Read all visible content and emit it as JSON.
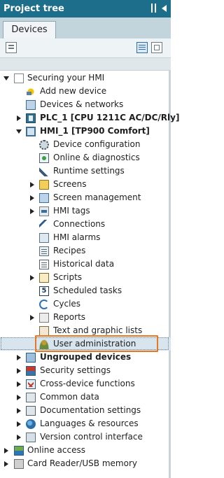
{
  "header": {
    "title": "Project tree"
  },
  "tabs": [
    {
      "label": "Devices"
    }
  ],
  "tree": {
    "rows": [
      {
        "label": "Securing your HMI"
      },
      {
        "label": "Add new device"
      },
      {
        "label": "Devices & networks"
      },
      {
        "label": "PLC_1 [CPU 1211C AC/DC/Rly]"
      },
      {
        "label": "HMI_1 [TP900 Comfort]"
      },
      {
        "label": "Device configuration"
      },
      {
        "label": "Online & diagnostics"
      },
      {
        "label": "Runtime settings"
      },
      {
        "label": "Screens"
      },
      {
        "label": "Screen management"
      },
      {
        "label": "HMI tags"
      },
      {
        "label": "Connections"
      },
      {
        "label": "HMI alarms"
      },
      {
        "label": "Recipes"
      },
      {
        "label": "Historical data"
      },
      {
        "label": "Scripts"
      },
      {
        "label": "Scheduled tasks"
      },
      {
        "label": "Cycles"
      },
      {
        "label": "Reports"
      },
      {
        "label": "Text and graphic lists"
      },
      {
        "label": "User administration"
      },
      {
        "label": "Ungrouped devices"
      },
      {
        "label": "Security settings"
      },
      {
        "label": "Cross-device functions"
      },
      {
        "label": "Common data"
      },
      {
        "label": "Documentation settings"
      },
      {
        "label": "Languages & resources"
      },
      {
        "label": "Version control interface"
      },
      {
        "label": "Online access"
      },
      {
        "label": "Card Reader/USB memory"
      }
    ],
    "task_icon_glyph": "5"
  },
  "icons": {
    "titlebar": [
      "pin-icon",
      "collapse-icon"
    ],
    "toolbar": [
      "properties-icon",
      "list-view-icon",
      "detail-view-icon"
    ]
  },
  "colors": {
    "titlebar": "#1c6e8b",
    "highlight": "#e87722"
  }
}
